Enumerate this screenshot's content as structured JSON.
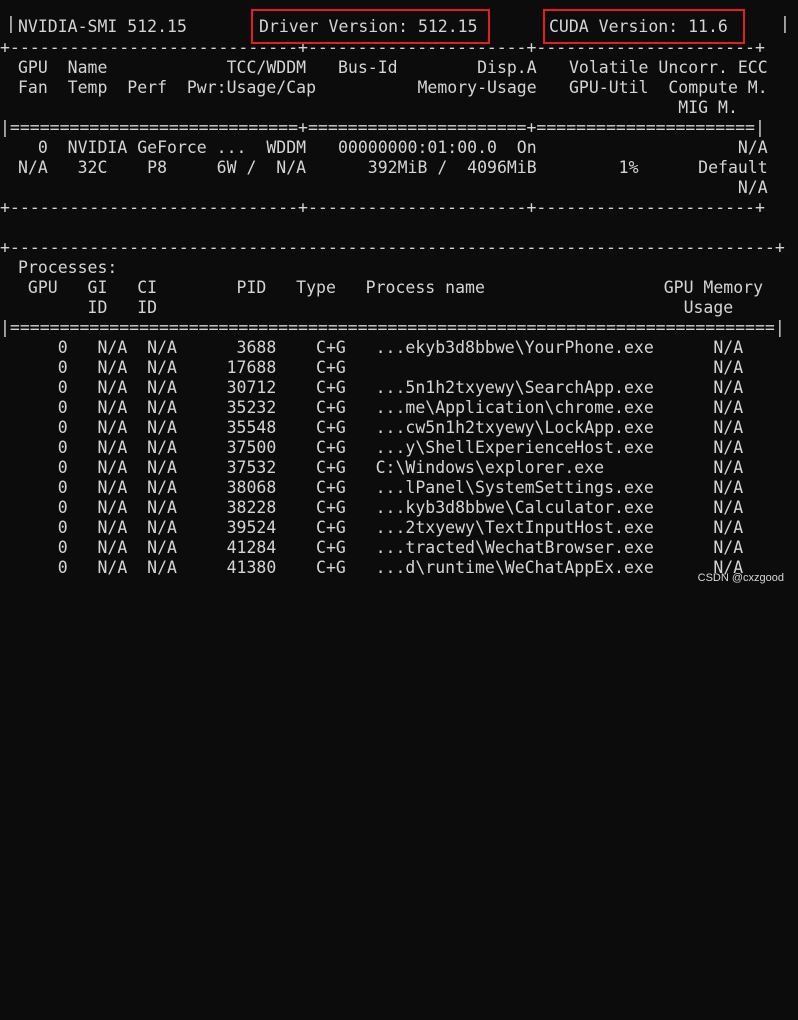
{
  "header": {
    "smi_label": "NVIDIA-SMI 512.15",
    "driver_label": "Driver Version: 512.15",
    "cuda_label": "CUDA Version: 11.6"
  },
  "gpu_table": {
    "header_left": [
      "GPU  Name            TCC/WDDM",
      "Fan  Temp  Perf  Pwr:Usage/Cap"
    ],
    "header_mid": [
      "Bus-Id        Disp.A",
      "        Memory-Usage"
    ],
    "header_right": [
      "Volatile Uncorr. ECC",
      "GPU-Util  Compute M.",
      "           MIG M."
    ],
    "row_left": [
      "  0  NVIDIA GeForce ...  WDDM",
      "N/A   32C    P8     6W /  N/A"
    ],
    "row_mid": [
      "00000000:01:00.0  On",
      "   392MiB /  4096MiB"
    ],
    "row_right": [
      "                 N/A",
      "     1%      Default",
      "                 N/A"
    ]
  },
  "processes": {
    "title": "Processes:",
    "header": [
      " GPU   GI   CI        PID   Type   Process name                  GPU Memory",
      "       ID   ID                                                     Usage"
    ],
    "rows": [
      "    0   N/A  N/A      3688    C+G   ...ekyb3d8bbwe\\YourPhone.exe      N/A",
      "    0   N/A  N/A     17688    C+G                                     N/A",
      "    0   N/A  N/A     30712    C+G   ...5n1h2txyewy\\SearchApp.exe      N/A",
      "    0   N/A  N/A     35232    C+G   ...me\\Application\\chrome.exe      N/A",
      "    0   N/A  N/A     35548    C+G   ...cw5n1h2txyewy\\LockApp.exe      N/A",
      "    0   N/A  N/A     37500    C+G   ...y\\ShellExperienceHost.exe      N/A",
      "    0   N/A  N/A     37532    C+G   C:\\Windows\\explorer.exe           N/A",
      "    0   N/A  N/A     38068    C+G   ...lPanel\\SystemSettings.exe      N/A",
      "    0   N/A  N/A     38228    C+G   ...kyb3d8bbwe\\Calculator.exe      N/A",
      "    0   N/A  N/A     39524    C+G   ...2txyewy\\TextInputHost.exe      N/A",
      "    0   N/A  N/A     41284    C+G   ...tracted\\WechatBrowser.exe      N/A",
      "    0   N/A  N/A     41380    C+G   ...d\\runtime\\WeChatAppEx.exe      N/A"
    ]
  },
  "watermark": "CSDN @cxzgood",
  "highlight_color": "#e51d1d"
}
